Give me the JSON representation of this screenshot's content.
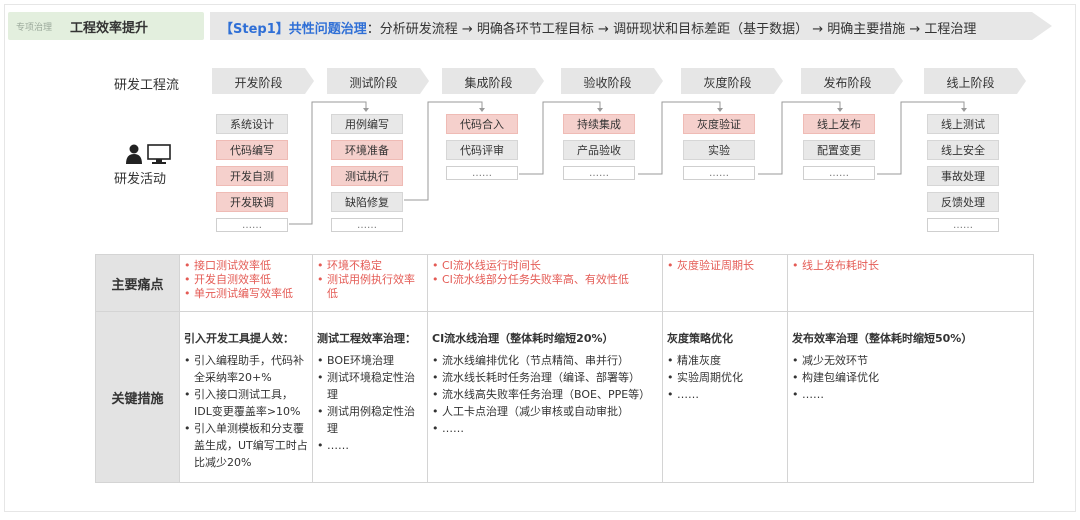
{
  "tag": {
    "small": "专项治理",
    "title": "工程效率提升"
  },
  "banner": {
    "step": "【Step1】共性问题治理",
    "text": "：分析研发流程 → 明确各环节工程目标 → 调研现状和目标差距（基于数据） → 明确主要措施 → 工程治理"
  },
  "labels": {
    "flow": "研发工程流",
    "activities": "研发活动"
  },
  "stages": [
    {
      "name": "开发阶段",
      "acts": [
        {
          "t": "系统设计",
          "h": false
        },
        {
          "t": "代码编写",
          "h": true
        },
        {
          "t": "开发自测",
          "h": true
        },
        {
          "t": "开发联调",
          "h": true
        },
        {
          "t": "……",
          "h": false
        }
      ]
    },
    {
      "name": "测试阶段",
      "acts": [
        {
          "t": "用例编写",
          "h": false
        },
        {
          "t": "环境准备",
          "h": true
        },
        {
          "t": "测试执行",
          "h": true
        },
        {
          "t": "缺陷修复",
          "h": false
        },
        {
          "t": "……",
          "h": false
        }
      ]
    },
    {
      "name": "集成阶段",
      "acts": [
        {
          "t": "代码合入",
          "h": true
        },
        {
          "t": "代码评审",
          "h": false
        },
        {
          "t": "……",
          "h": false
        }
      ]
    },
    {
      "name": "验收阶段",
      "acts": [
        {
          "t": "持续集成",
          "h": true
        },
        {
          "t": "产品验收",
          "h": false
        },
        {
          "t": "……",
          "h": false
        }
      ]
    },
    {
      "name": "灰度阶段",
      "acts": [
        {
          "t": "灰度验证",
          "h": true
        },
        {
          "t": "实验",
          "h": false
        },
        {
          "t": "……",
          "h": false
        }
      ]
    },
    {
      "name": "发布阶段",
      "acts": [
        {
          "t": "线上发布",
          "h": true
        },
        {
          "t": "配置变更",
          "h": false
        },
        {
          "t": "……",
          "h": false
        }
      ]
    },
    {
      "name": "线上阶段",
      "acts": [
        {
          "t": "线上测试",
          "h": false
        },
        {
          "t": "线上安全",
          "h": false
        },
        {
          "t": "事故处理",
          "h": false
        },
        {
          "t": "反馈处理",
          "h": false
        },
        {
          "t": "……",
          "h": false
        }
      ]
    }
  ],
  "table": {
    "pain_head": "主要痛点",
    "measure_head": "关键措施",
    "pains": [
      [
        "接口测试效率低",
        "开发自测效率低",
        "单元测试编写效率低"
      ],
      [
        "环境不稳定",
        "测试用例执行效率低"
      ],
      [
        "CI流水线运行时间长",
        "CI流水线部分任务失败率高、有效性低"
      ],
      [
        "灰度验证周期长"
      ],
      [
        "线上发布耗时长"
      ]
    ],
    "measures": [
      {
        "title": "引入开发工具提人效：",
        "items": [
          "引入编程助手，代码补全采纳率20+%",
          "引入接口测试工具，IDL变更覆盖率>10%",
          "引入单测模板和分支覆盖生成，UT编写工时占比减少20%"
        ]
      },
      {
        "title": "测试工程效率治理：",
        "items": [
          "BOE环境治理",
          "测试环境稳定性治理",
          "测试用例稳定性治理",
          "……"
        ]
      },
      {
        "title": "CI流水线治理（整体耗时缩短20%）",
        "items": [
          "流水线编排优化（节点精简、串并行）",
          "流水线长耗时任务治理（编译、部署等）",
          "流水线高失败率任务治理（BOE、PPE等）",
          "人工卡点治理（减少审核或自动审批）",
          "……"
        ]
      },
      {
        "title": "灰度策略优化",
        "items": [
          "精准灰度",
          "实验周期优化",
          "……"
        ]
      },
      {
        "title": "发布效率治理（整体耗时缩短50%）",
        "items": [
          "减少无效环节",
          "构建包编译优化",
          "……"
        ]
      }
    ]
  }
}
